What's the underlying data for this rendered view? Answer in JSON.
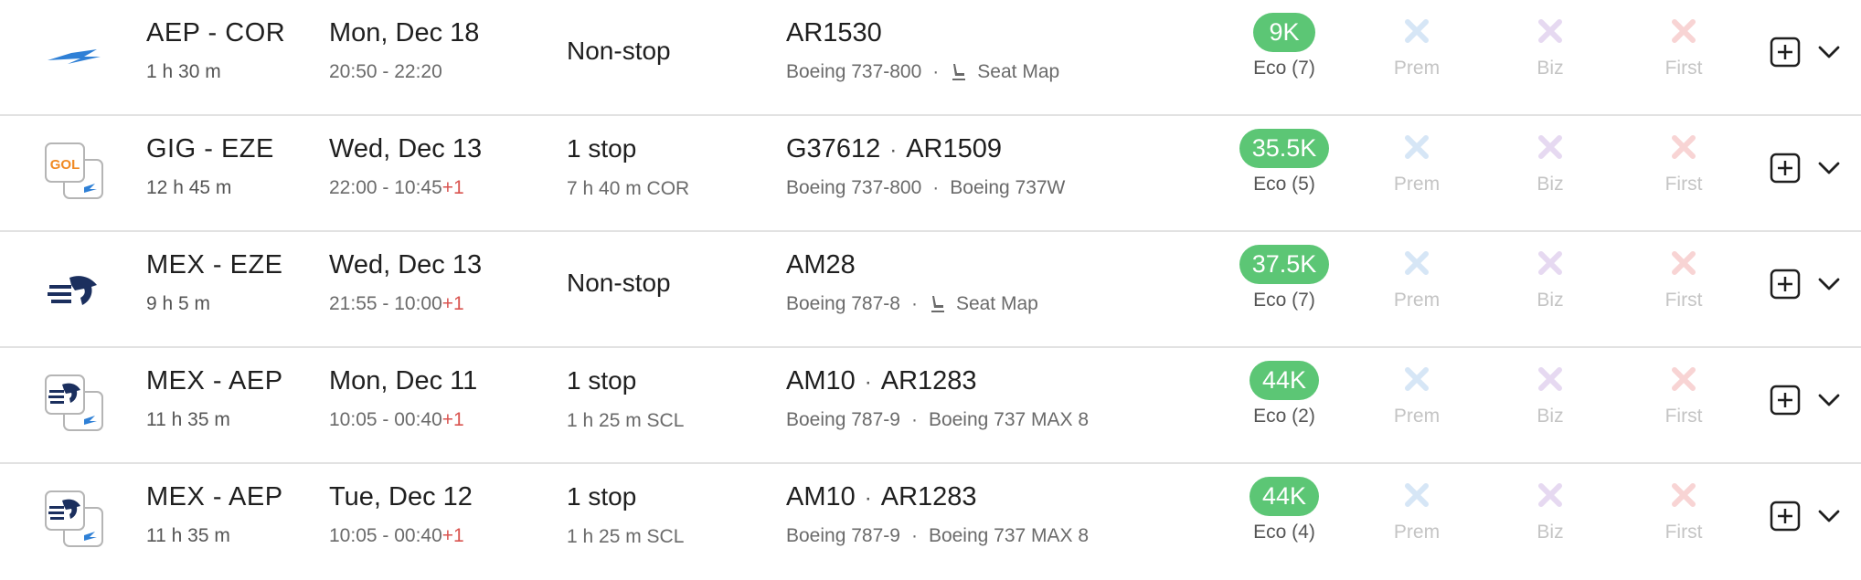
{
  "colors": {
    "eco_pill": "#5cc675",
    "prem_x": "#d6e6f6",
    "biz_x": "#e6d9f1",
    "first_x": "#f8d4d4",
    "next_day": "#d9534f"
  },
  "results": [
    {
      "airline_icon": "aerolineas-argentinas-logo",
      "route": "AEP - COR",
      "duration": "1 h 30 m",
      "date": "Mon, Dec 18",
      "times": "20:50 - 22:20",
      "next_day": "",
      "stops": "Non-stop",
      "via": "",
      "flights": [
        "AR1530"
      ],
      "aircraft": [
        "Boeing 737-800"
      ],
      "seat_map": "Seat Map",
      "eco_points": "9K",
      "eco_seats": "Eco (7)",
      "prem": "Prem",
      "biz": "Biz",
      "first": "First"
    },
    {
      "airline_icon": "gol-aerolineas-multi-logo",
      "route": "GIG - EZE",
      "duration": "12 h 45 m",
      "date": "Wed, Dec 13",
      "times": "22:00 - 10:45",
      "next_day": "+1",
      "stops": "1 stop",
      "via": "7 h 40 m  COR",
      "flights": [
        "G37612",
        "AR1509"
      ],
      "aircraft": [
        "Boeing 737-800",
        "Boeing 737W"
      ],
      "seat_map": "",
      "eco_points": "35.5K",
      "eco_seats": "Eco (5)",
      "prem": "Prem",
      "biz": "Biz",
      "first": "First"
    },
    {
      "airline_icon": "aeromexico-logo",
      "route": "MEX - EZE",
      "duration": "9 h 5 m",
      "date": "Wed, Dec 13",
      "times": "21:55 - 10:00",
      "next_day": "+1",
      "stops": "Non-stop",
      "via": "",
      "flights": [
        "AM28"
      ],
      "aircraft": [
        "Boeing 787-8"
      ],
      "seat_map": "Seat Map",
      "eco_points": "37.5K",
      "eco_seats": "Eco (7)",
      "prem": "Prem",
      "biz": "Biz",
      "first": "First"
    },
    {
      "airline_icon": "aeromexico-aerolineas-multi-logo",
      "route": "MEX - AEP",
      "duration": "11 h 35 m",
      "date": "Mon, Dec 11",
      "times": "10:05 - 00:40",
      "next_day": "+1",
      "stops": "1 stop",
      "via": "1 h 25 m  SCL",
      "flights": [
        "AM10",
        "AR1283"
      ],
      "aircraft": [
        "Boeing 787-9",
        "Boeing 737 MAX 8"
      ],
      "seat_map": "",
      "eco_points": "44K",
      "eco_seats": "Eco (2)",
      "prem": "Prem",
      "biz": "Biz",
      "first": "First"
    },
    {
      "airline_icon": "aeromexico-aerolineas-multi-logo",
      "route": "MEX - AEP",
      "duration": "11 h 35 m",
      "date": "Tue, Dec 12",
      "times": "10:05 - 00:40",
      "next_day": "+1",
      "stops": "1 stop",
      "via": "1 h 25 m  SCL",
      "flights": [
        "AM10",
        "AR1283"
      ],
      "aircraft": [
        "Boeing 787-9",
        "Boeing 737 MAX 8"
      ],
      "seat_map": "",
      "eco_points": "44K",
      "eco_seats": "Eco (4)",
      "prem": "Prem",
      "biz": "Biz",
      "first": "First"
    }
  ]
}
